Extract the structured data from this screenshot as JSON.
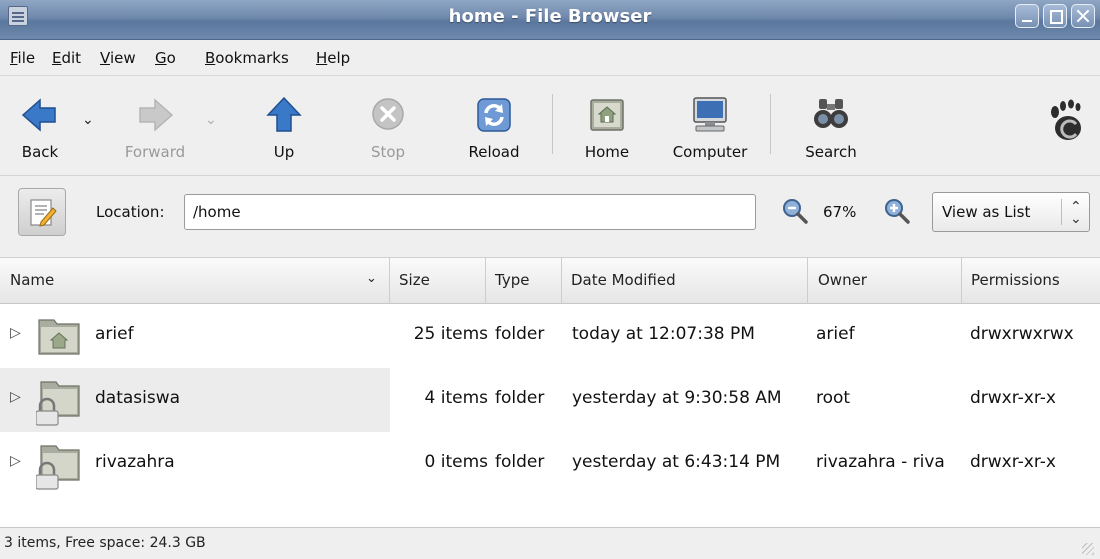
{
  "window": {
    "title": "home - File Browser"
  },
  "menu": {
    "file": {
      "mnemonic": "F",
      "rest": "ile"
    },
    "edit": {
      "mnemonic": "E",
      "rest": "dit"
    },
    "view": {
      "mnemonic": "V",
      "rest": "iew"
    },
    "go": {
      "mnemonic": "G",
      "rest": "o"
    },
    "bookmarks": {
      "mnemonic": "B",
      "rest": "ookmarks"
    },
    "help": {
      "mnemonic": "H",
      "rest": "elp"
    }
  },
  "toolbar": {
    "back": "Back",
    "forward": "Forward",
    "up": "Up",
    "stop": "Stop",
    "reload": "Reload",
    "home": "Home",
    "computer": "Computer",
    "search": "Search"
  },
  "location": {
    "label": "Location:",
    "value": "/home",
    "zoom": "67%",
    "view_mode": "View as List"
  },
  "columns": {
    "name": "Name",
    "size": "Size",
    "type": "Type",
    "date": "Date Modified",
    "owner": "Owner",
    "permissions": "Permissions"
  },
  "files": [
    {
      "name": "arief",
      "size": "25 items",
      "type": "folder",
      "date": "today at 12:07:38 PM",
      "owner": "arief",
      "permissions": "drwxrwxrwx",
      "icon": "home-folder-icon"
    },
    {
      "name": "datasiswa",
      "size": "4 items",
      "type": "folder",
      "date": "yesterday at 9:30:58 AM",
      "owner": "root",
      "permissions": "drwxr-xr-x",
      "icon": "locked-folder-icon"
    },
    {
      "name": "rivazahra",
      "size": "0 items",
      "type": "folder",
      "date": "yesterday at 6:43:14 PM",
      "owner": "rivazahra - riva",
      "permissions": "drwxr-xr-x",
      "icon": "locked-folder-icon"
    }
  ],
  "status": {
    "text": "3 items, Free space: 24.3 GB"
  },
  "colors": {
    "titlebar": "#6f89ad",
    "accent_blue": "#3a78c8",
    "selection_row": "#ececec"
  }
}
